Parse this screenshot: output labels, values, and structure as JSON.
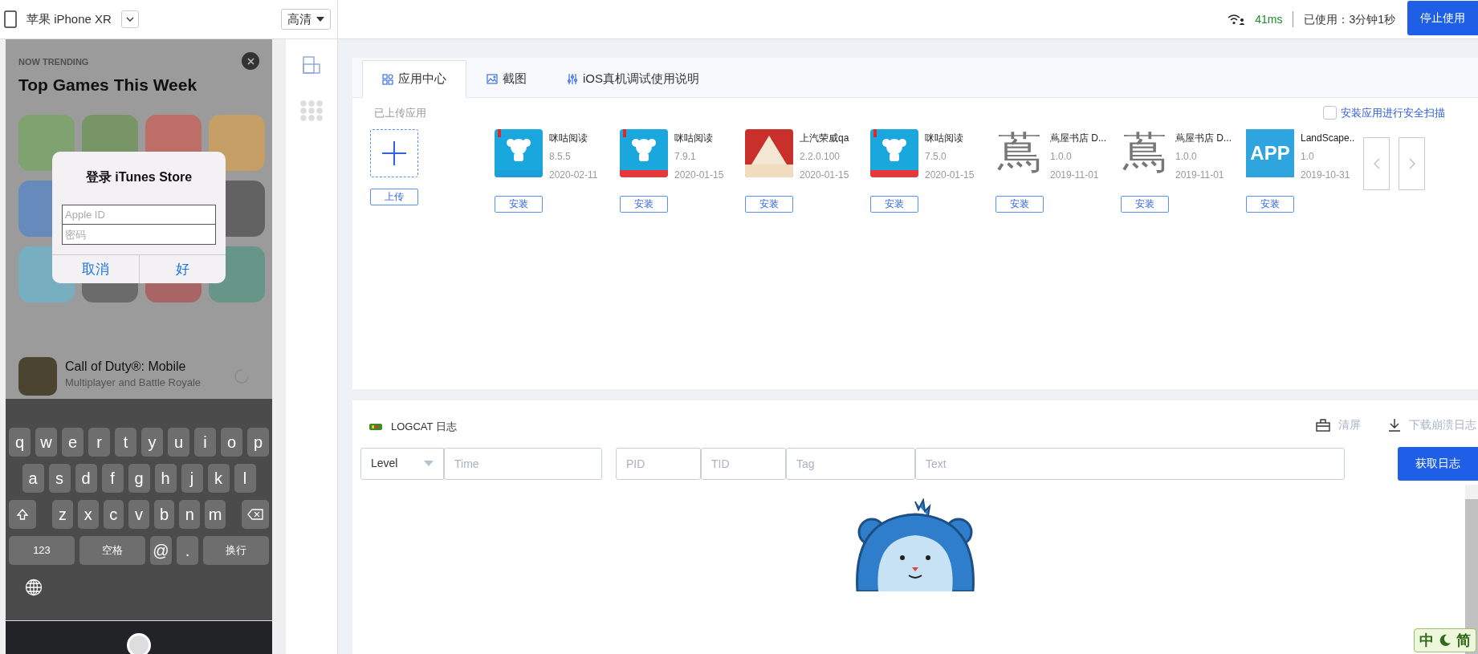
{
  "device_bar": {
    "device_name": "苹果 iPhone XR",
    "quality": "高清"
  },
  "status": {
    "latency": "41ms",
    "used_time": "已使用：3分钟1秒",
    "stop_button": "停止使用"
  },
  "phone": {
    "trending_label": "NOW TRENDING",
    "heading": "Top Games This Week",
    "dialog": {
      "title": "登录 iTunes Store",
      "fields": [
        {
          "placeholder": "Apple ID"
        },
        {
          "placeholder": "密码"
        }
      ],
      "buttons": [
        "取消",
        "好"
      ]
    },
    "featured_app": {
      "name": "Call of Duty®: Mobile",
      "subtitle": "Multiplayer and Battle Royale"
    },
    "keyboard": {
      "rows": [
        {
          "keys": [
            {
              "kind": "key",
              "label": "q"
            },
            {
              "kind": "key",
              "label": "w"
            },
            {
              "kind": "key",
              "label": "e"
            },
            {
              "kind": "key",
              "label": "r"
            },
            {
              "kind": "key",
              "label": "t"
            },
            {
              "kind": "key",
              "label": "y"
            },
            {
              "kind": "key",
              "label": "u"
            },
            {
              "kind": "key",
              "label": "i"
            },
            {
              "kind": "key",
              "label": "o"
            },
            {
              "kind": "key",
              "label": "p"
            }
          ]
        },
        {
          "keys": [
            {
              "kind": "key",
              "label": "a"
            },
            {
              "kind": "key",
              "label": "s"
            },
            {
              "kind": "key",
              "label": "d"
            },
            {
              "kind": "key",
              "label": "f"
            },
            {
              "kind": "key",
              "label": "g"
            },
            {
              "kind": "key",
              "label": "h"
            },
            {
              "kind": "key",
              "label": "j"
            },
            {
              "kind": "key",
              "label": "k"
            },
            {
              "kind": "key",
              "label": "l"
            }
          ]
        },
        {
          "keys": [
            {
              "kind": "shift"
            },
            {
              "kind": "key",
              "label": "z"
            },
            {
              "kind": "key",
              "label": "x"
            },
            {
              "kind": "key",
              "label": "c"
            },
            {
              "kind": "key",
              "label": "v"
            },
            {
              "kind": "key",
              "label": "b"
            },
            {
              "kind": "key",
              "label": "n"
            },
            {
              "kind": "key",
              "label": "m"
            },
            {
              "kind": "backspace"
            }
          ]
        },
        {
          "keys": [
            {
              "kind": "wide",
              "label": "123"
            },
            {
              "kind": "wide",
              "label": "空格"
            },
            {
              "kind": "key",
              "label": "@"
            },
            {
              "kind": "key",
              "label": "."
            },
            {
              "kind": "wide",
              "label": "换行"
            }
          ]
        },
        {
          "keys": [
            {
              "kind": "globe"
            }
          ]
        }
      ]
    }
  },
  "tabs": [
    {
      "label": "应用中心",
      "selected": true
    },
    {
      "label": "截图",
      "selected": false
    },
    {
      "label": "iOS真机调试使用说明",
      "selected": false
    }
  ],
  "app_center": {
    "section_label": "已上传应用",
    "scan_checkbox": {
      "label": "安装应用进行安全扫描",
      "checked": false
    },
    "upload_button": "上传",
    "apps": [
      {
        "name": "咪咕阅读",
        "version": "8.5.5",
        "date": "2020-02-11",
        "install_button": "安装",
        "icon": {
          "kind": "migu",
          "color": "#1a9fd8"
        }
      },
      {
        "name": "咪咕阅读",
        "version": "7.9.1",
        "date": "2020-01-15",
        "install_button": "安装",
        "icon": {
          "kind": "migu",
          "color": "#e8373a"
        }
      },
      {
        "name": "上汽荣威qa",
        "version": "2.2.0.100",
        "date": "2020-01-15",
        "install_button": "安装",
        "icon": {
          "kind": "photo"
        }
      },
      {
        "name": "咪咕阅读",
        "version": "7.5.0",
        "date": "2020-01-15",
        "install_button": "安装",
        "icon": {
          "kind": "migu",
          "color": "#e8373a"
        }
      },
      {
        "name": "蔦屋书店 D...",
        "version": "1.0.0",
        "date": "2019-11-01",
        "install_button": "安装",
        "icon": {
          "kind": "glyph",
          "text": "蔦"
        }
      },
      {
        "name": "蔦屋书店 D...",
        "version": "1.0.0",
        "date": "2019-11-01",
        "install_button": "安装",
        "icon": {
          "kind": "glyph",
          "text": "蔦"
        }
      },
      {
        "name": "LandScape..",
        "version": "1.0",
        "date": "2019-10-31",
        "install_button": "安装",
        "icon": {
          "kind": "badge",
          "text": "APP"
        }
      }
    ]
  },
  "logcat": {
    "title": "LOGCAT 日志",
    "actions": [
      {
        "kind": "clear",
        "label": "清屏"
      },
      {
        "kind": "download",
        "label": "下载崩溃日志"
      }
    ],
    "level_select": "Level",
    "filters": [
      {
        "placeholder": "Time"
      },
      {
        "placeholder": "PID"
      },
      {
        "placeholder": "TID"
      },
      {
        "placeholder": "Tag"
      },
      {
        "placeholder": "Text"
      }
    ],
    "fetch_button": "获取日志"
  },
  "ime_indicator": {
    "mode": "中",
    "script": "简"
  }
}
